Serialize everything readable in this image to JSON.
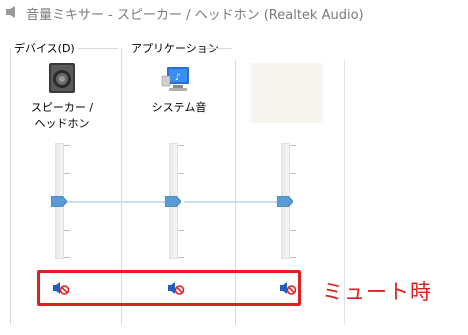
{
  "window": {
    "title": "音量ミキサー - スピーカー / ヘッドホン (Realtek Audio)"
  },
  "sections": {
    "device_label": "デバイス(D)",
    "applications_label": "アプリケーション"
  },
  "channels": [
    {
      "name_line1": "スピーカー /",
      "name_line2": "ヘッドホン",
      "icon": "speaker-icon",
      "muted": true
    },
    {
      "name_line1": "システム音",
      "name_line2": "",
      "icon": "system-sounds-icon",
      "muted": true
    },
    {
      "name_line1": "",
      "name_line2": "",
      "icon": "blank-app-icon",
      "muted": true
    }
  ],
  "annotation": {
    "text": "ミュート時",
    "color": "#e02020"
  },
  "colors": {
    "slider_thumb": "#5b9bd5",
    "mute_red": "#e02020",
    "speaker_blue": "#1f5fbf"
  }
}
